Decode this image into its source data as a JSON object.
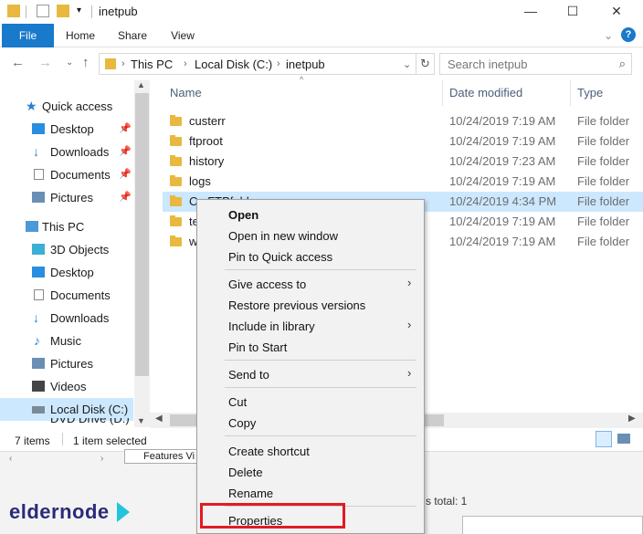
{
  "window": {
    "title": "inetpub"
  },
  "ribbon": {
    "tabs": [
      "File",
      "Home",
      "Share",
      "View"
    ]
  },
  "address": {
    "path": [
      "This PC",
      "Local Disk (C:)",
      "inetpub"
    ]
  },
  "search": {
    "placeholder": "Search inetpub"
  },
  "nav": {
    "quick_access": "Quick access",
    "quick_items": [
      "Desktop",
      "Downloads",
      "Documents",
      "Pictures"
    ],
    "this_pc": "This PC",
    "pc_items": [
      "3D Objects",
      "Desktop",
      "Documents",
      "Downloads",
      "Music",
      "Pictures",
      "Videos",
      "Local Disk (C:)",
      "DVD Drive (D:) S"
    ]
  },
  "columns": {
    "name": "Name",
    "date": "Date modified",
    "type": "Type"
  },
  "files": [
    {
      "name": "custerr",
      "date": "10/24/2019 7:19 AM",
      "type": "File folder"
    },
    {
      "name": "ftproot",
      "date": "10/24/2019 7:19 AM",
      "type": "File folder"
    },
    {
      "name": "history",
      "date": "10/24/2019 7:23 AM",
      "type": "File folder"
    },
    {
      "name": "logs",
      "date": "10/24/2019 7:19 AM",
      "type": "File folder"
    },
    {
      "name": "C...FTPfolder",
      "date": "10/24/2019 4:34 PM",
      "type": "File folder"
    },
    {
      "name": "te",
      "date": "10/24/2019 7:19 AM",
      "type": "File folder"
    },
    {
      "name": "w",
      "date": "10/24/2019 7:19 AM",
      "type": "File folder"
    }
  ],
  "status": {
    "count": "7 items",
    "selected": "1 item selected"
  },
  "background": {
    "tab": "Features Vi",
    "total": "s total: 1"
  },
  "context_menu": {
    "items": [
      "Open",
      "Open in new window",
      "Pin to Quick access",
      "Give access to",
      "Restore previous versions",
      "Include in library",
      "Pin to Start",
      "Send to",
      "Cut",
      "Copy",
      "Create shortcut",
      "Delete",
      "Rename",
      "Properties"
    ]
  },
  "logo": {
    "text": "eldernode"
  },
  "colors": {
    "accent": "#1979ca",
    "selection": "#cce8ff",
    "highlight": "#e21b23",
    "folder": "#e8b93e"
  }
}
